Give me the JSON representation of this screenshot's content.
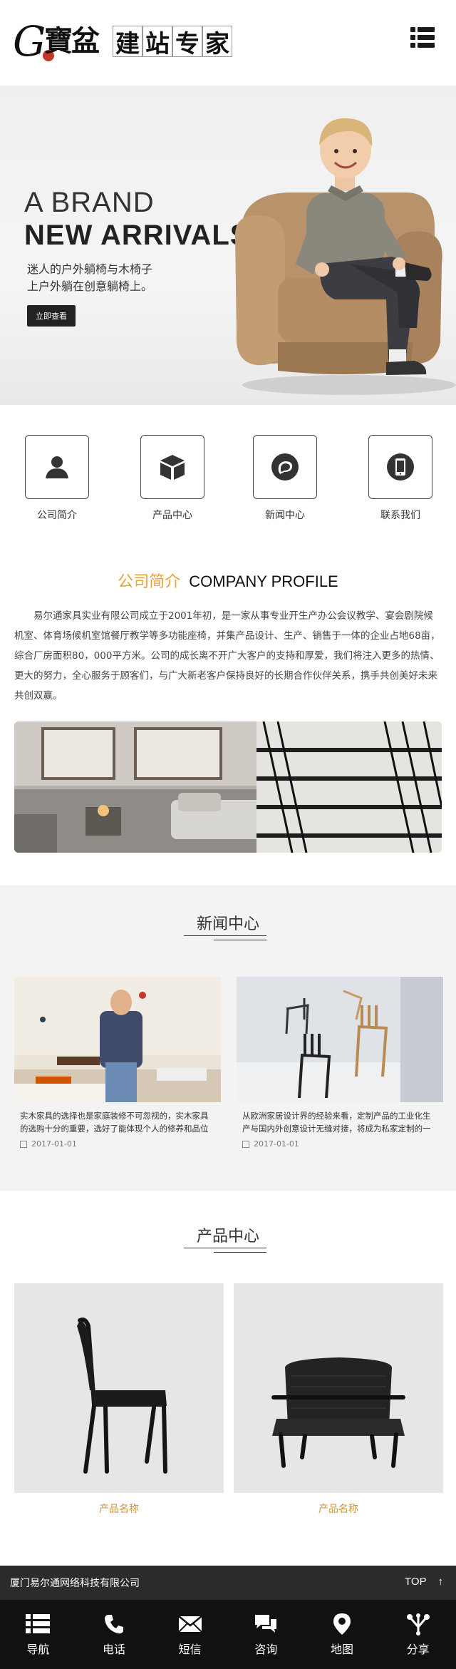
{
  "header": {
    "logo_g": "G",
    "logo_brand": "寶盆",
    "logo_chars": [
      "建",
      "站",
      "专",
      "家"
    ],
    "menu_icon": "menu-list-icon"
  },
  "banner": {
    "line1": "A BRAND",
    "line2": "NEW ARRIVALS",
    "sub1": "迷人的户外躺椅与木椅子",
    "sub2": "上户外躺在创意躺椅上。",
    "button": "立即查看"
  },
  "iconnav": [
    {
      "label": "公司简介",
      "icon": "user-icon"
    },
    {
      "label": "产品中心",
      "icon": "box-icon"
    },
    {
      "label": "新闻中心",
      "icon": "chat-icon"
    },
    {
      "label": "联系我们",
      "icon": "phone-icon"
    }
  ],
  "profile": {
    "title_cn": "公司简介",
    "title_en": "COMPANY PROFILE",
    "text": "易尔通家具实业有限公司成立于2001年初，是一家从事专业开生产办公会议教学、宴会剧院候机室、体育场候机室馆餐厅教学等多功能座椅，并集产品设计、生产、销售于一体的企业占地68亩，综合厂房面积80，000平方米。公司的成长离不开广大客户的支持和厚爱，我们将注入更多的热情、更大的努力，全心服务于顾客们，与广大新老客户保持良好的长期合作伙伴关系，携手共创美好未来共创双赢。"
  },
  "news": {
    "title": "新闻中心",
    "items": [
      {
        "text": "实木家具的选择也是家庭装修不可忽视的，实木家具的选购十分的重要，选好了能体现个人的修养和品位",
        "date": "2017-01-01"
      },
      {
        "text": "从欧洲家居设计界的经验来看，定制产品的工业化生产与国内外创意设计无缝对接，将成为私家定制的一",
        "date": "2017-01-01"
      }
    ]
  },
  "products": {
    "title": "产品中心",
    "items": [
      {
        "name": "产品名称"
      },
      {
        "name": "产品名称"
      }
    ]
  },
  "footer": {
    "company": "厦门易尔通网络科技有限公司",
    "top": "TOP",
    "top_icon": "arrow-up-icon"
  },
  "bottomnav": [
    {
      "label": "导航",
      "icon": "menu-icon"
    },
    {
      "label": "电话",
      "icon": "phone-icon"
    },
    {
      "label": "短信",
      "icon": "mail-icon"
    },
    {
      "label": "咨询",
      "icon": "chat-icon"
    },
    {
      "label": "地图",
      "icon": "map-pin-icon"
    },
    {
      "label": "分享",
      "icon": "share-icon"
    }
  ],
  "colors": {
    "accent": "#e8a33a",
    "product_name": "#c99640",
    "footer_bar": "#2b2b2b",
    "bottom_nav": "#111111"
  }
}
